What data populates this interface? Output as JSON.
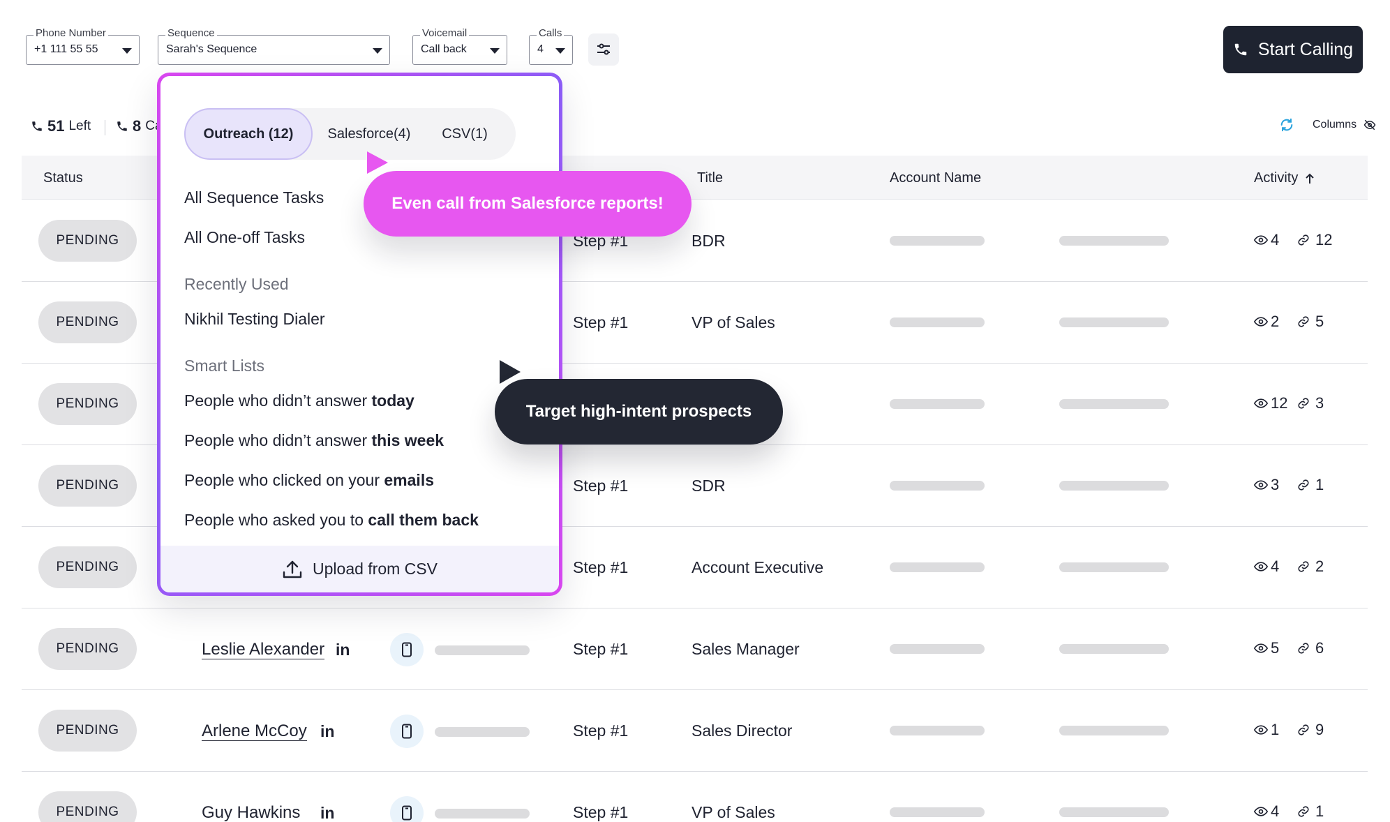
{
  "toolbar": {
    "phone": {
      "label": "Phone Number",
      "value": "+1 111 55 55"
    },
    "sequence": {
      "label": "Sequence",
      "value": "Sarah's Sequence"
    },
    "voicemail": {
      "label": "Voicemail",
      "value": "Call back"
    },
    "calls": {
      "label": "Calls",
      "value": "4"
    },
    "start_calling": "Start Calling"
  },
  "stats": {
    "left_count": "51",
    "left_label": "Left",
    "second_count": "8",
    "second_label": "Ca"
  },
  "columns_label": "Columns",
  "table": {
    "headers": {
      "status": "Status",
      "title": "Title",
      "account": "Account Name",
      "activity": "Activity"
    },
    "rows": [
      {
        "status": "PENDING",
        "name": "",
        "step": "Step #1",
        "title": "BDR",
        "views": "4",
        "links": "12"
      },
      {
        "status": "PENDING",
        "name": "",
        "step": "Step #1",
        "title": "VP of Sales",
        "views": "2",
        "links": "5"
      },
      {
        "status": "PENDING",
        "name": "",
        "step": "",
        "title": "",
        "views": "12",
        "links": "3"
      },
      {
        "status": "PENDING",
        "name": "",
        "step": "Step #1",
        "title": "SDR",
        "views": "3",
        "links": "1"
      },
      {
        "status": "PENDING",
        "name": "",
        "step": "Step #1",
        "title": "Account Executive",
        "views": "4",
        "links": "2"
      },
      {
        "status": "PENDING",
        "name": "Leslie Alexander",
        "linkedin": "in",
        "step": "Step #1",
        "title": "Sales Manager",
        "views": "5",
        "links": "6"
      },
      {
        "status": "PENDING",
        "name": "Arlene McCoy",
        "linkedin": "in",
        "step": "Step #1",
        "title": "Sales Director",
        "views": "1",
        "links": "9"
      },
      {
        "status": "PENDING",
        "name": "Guy Hawkins",
        "linkedin": "in",
        "step": "Step #1",
        "title": "VP of Sales",
        "views": "4",
        "links": "1"
      }
    ]
  },
  "panel": {
    "tabs": [
      "Outreach (12)",
      "Salesforce(4)",
      "CSV(1)"
    ],
    "all_sequence_tasks": "All Sequence Tasks",
    "all_oneoff_tasks": "All One-off Tasks",
    "recently_used": "Recently Used",
    "recent_item": "Nikhil Testing Dialer",
    "smart_lists": "Smart Lists",
    "smart": [
      {
        "pre": "People who didn’t answer ",
        "bold": "today"
      },
      {
        "pre": "People who didn’t answer ",
        "bold": "this week"
      },
      {
        "pre": "People who clicked on your ",
        "bold": "emails"
      },
      {
        "pre": "People who asked you to ",
        "bold": "call them back"
      }
    ],
    "upload": "Upload from CSV"
  },
  "callouts": {
    "pink": "Even call from Salesforce reports!",
    "dark": "Target high-intent prospects"
  },
  "colors": {
    "pink": "#e757f0",
    "dark": "#232733",
    "accent_purple": "#8b5cf6"
  }
}
